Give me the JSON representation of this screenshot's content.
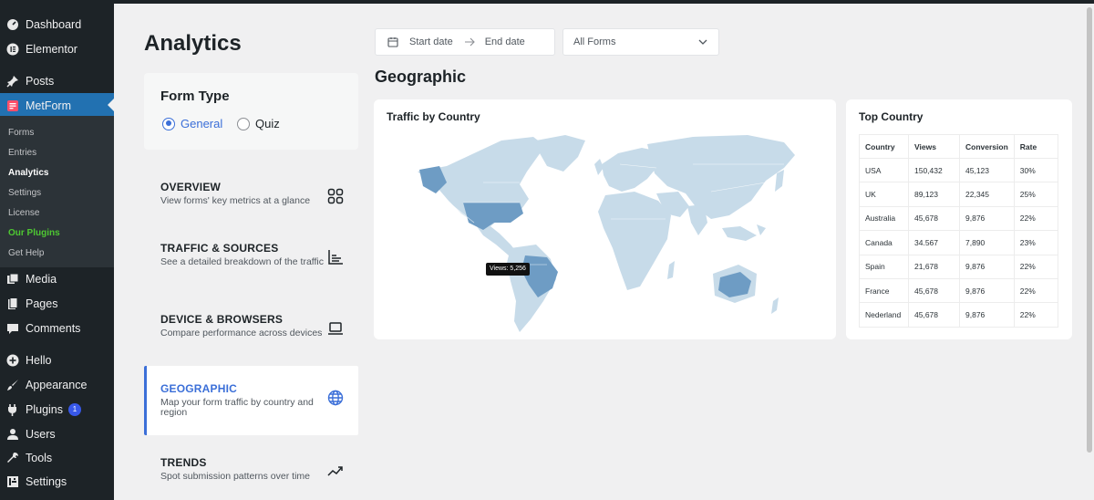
{
  "sidebar": {
    "items": [
      {
        "label": "Dashboard",
        "icon": "dashboard-icon"
      },
      {
        "label": "Elementor",
        "icon": "elementor-icon"
      },
      {
        "label": "Posts",
        "icon": "pin-icon"
      },
      {
        "label": "MetForm",
        "icon": "metform-icon"
      },
      {
        "label": "Media",
        "icon": "media-icon"
      },
      {
        "label": "Pages",
        "icon": "pages-icon"
      },
      {
        "label": "Comments",
        "icon": "comments-icon"
      },
      {
        "label": "Hello",
        "icon": "plus-circle-icon"
      },
      {
        "label": "Appearance",
        "icon": "brush-icon"
      },
      {
        "label": "Plugins",
        "icon": "plugin-icon",
        "badge": "1"
      },
      {
        "label": "Users",
        "icon": "user-icon"
      },
      {
        "label": "Tools",
        "icon": "wrench-icon"
      },
      {
        "label": "Settings",
        "icon": "settings-icon"
      }
    ],
    "submenu": [
      "Forms",
      "Entries",
      "Analytics",
      "Settings",
      "License",
      "Our Plugins",
      "Get Help"
    ]
  },
  "page": {
    "title": "Analytics"
  },
  "form_type": {
    "title": "Form Type",
    "options": [
      "General",
      "Quiz"
    ],
    "selected": "General"
  },
  "nav": [
    {
      "title": "OVERVIEW",
      "desc": "View forms' key metrics at a glance",
      "icon": "grid-icon"
    },
    {
      "title": "TRAFFIC & SOURCES",
      "desc": "See a detailed breakdown of the traffic",
      "icon": "bar-chart-icon"
    },
    {
      "title": "DEVICE & BROWSERS",
      "desc": "Compare performance across devices",
      "icon": "laptop-icon"
    },
    {
      "title": "GEOGRAPHIC",
      "desc": "Map your form traffic by country and region",
      "icon": "globe-icon"
    },
    {
      "title": "TRENDS",
      "desc": "Spot submission patterns over time",
      "icon": "trend-icon"
    }
  ],
  "filters": {
    "start_placeholder": "Start date",
    "end_placeholder": "End date",
    "forms_select": "All Forms"
  },
  "section": {
    "title": "Geographic"
  },
  "map": {
    "title": "Traffic by Country",
    "tooltip": "Views: 5,256",
    "highlight_color": "#6e9cc4",
    "base_color": "#c7dbe9"
  },
  "top_country": {
    "title": "Top Country",
    "headers": [
      "Country",
      "Views",
      "Conversion",
      "Rate"
    ],
    "rows": [
      [
        "USA",
        "150,432",
        "45,123",
        "30%"
      ],
      [
        "UK",
        "89,123",
        "22,345",
        "25%"
      ],
      [
        "Australia",
        "45,678",
        "9,876",
        "22%"
      ],
      [
        "Canada",
        "34.567",
        "7,890",
        "23%"
      ],
      [
        "Spain",
        "21,678",
        "9,876",
        "22%"
      ],
      [
        "France",
        "45,678",
        "9,876",
        "22%"
      ],
      [
        "Nederland",
        "45,678",
        "9,876",
        "22%"
      ]
    ]
  },
  "colors": {
    "accent": "#3b6fd8",
    "wp_sidebar": "#1d2327",
    "wp_active": "#2271b1",
    "submenu_green": "#4ec832"
  }
}
